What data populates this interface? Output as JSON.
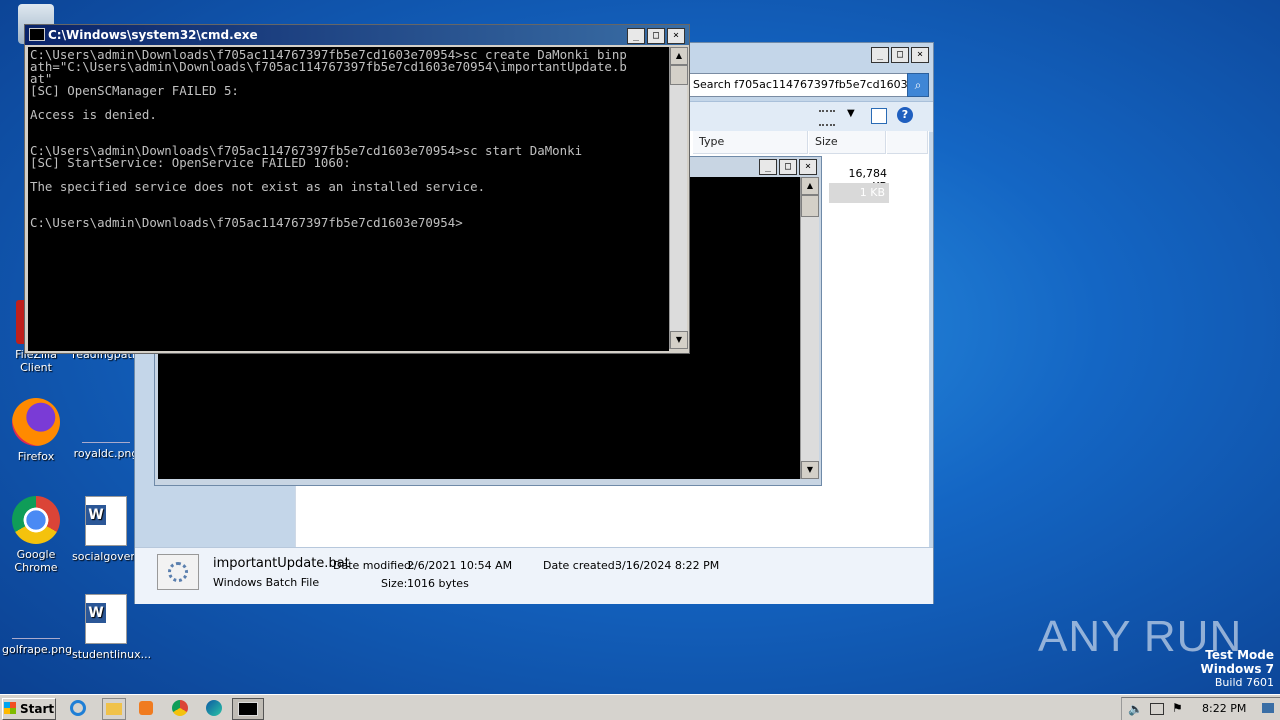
{
  "desktop": {
    "icons": [
      {
        "label": "FileZilla Client"
      },
      {
        "label": "readingpati..."
      },
      {
        "label": "Firefox"
      },
      {
        "label": "royaldc.png"
      },
      {
        "label": "Google Chrome"
      },
      {
        "label": "socialgover..."
      },
      {
        "label": "golfrape.png"
      },
      {
        "label": "studentlinux..."
      }
    ],
    "watermark": {
      "line1": "Test Mode",
      "line2": "Windows 7",
      "line3": "Build 7601"
    },
    "brand": "ANY RUN"
  },
  "explorer": {
    "search_value": "Search f705ac114767397fb5e7cd1603...",
    "columns": [
      "Type",
      "Size"
    ],
    "rows": [
      {
        "size": "16,784 KB"
      },
      {
        "size": "1 KB"
      }
    ],
    "details": {
      "filename": "importantUpdate.bat",
      "filetype": "Windows Batch File",
      "modified_label": "Date modified:",
      "modified_value": "2/6/2021 10:54 AM",
      "created_label": "Date created:",
      "created_value": "3/16/2024 8:22 PM",
      "size_label": "Size:",
      "size_value": "1016 bytes"
    }
  },
  "cmd": {
    "title": "C:\\Windows\\system32\\cmd.exe",
    "lines": [
      "C:\\Users\\admin\\Downloads\\f705ac114767397fb5e7cd1603e70954>sc create DaMonki binp",
      "ath=\"C:\\Users\\admin\\Downloads\\f705ac114767397fb5e7cd1603e70954\\importantUpdate.b",
      "at\"",
      "[SC] OpenSCManager FAILED 5:",
      "",
      "Access is denied.",
      "",
      "",
      "C:\\Users\\admin\\Downloads\\f705ac114767397fb5e7cd1603e70954>sc start DaMonki",
      "[SC] StartService: OpenService FAILED 1060:",
      "",
      "The specified service does not exist as an installed service.",
      "",
      "",
      "C:\\Users\\admin\\Downloads\\f705ac114767397fb5e7cd1603e70954>"
    ]
  },
  "taskbar": {
    "start_label": "Start",
    "clock": "8:22 PM"
  },
  "colors": {
    "cmd_bg": "#000000",
    "cmd_fg": "#c0c0c0",
    "title_blue": "#0a246a"
  }
}
